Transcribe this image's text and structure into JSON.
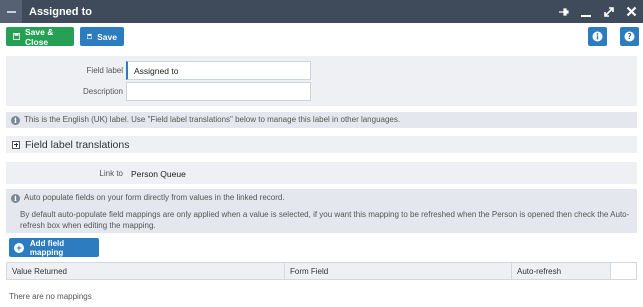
{
  "titlebar": {
    "title": "Assigned to"
  },
  "toolbar": {
    "save_close_label": "Save & Close",
    "save_label": "Save"
  },
  "form": {
    "field_label_caption": "Field label",
    "field_label_value": "Assigned to",
    "description_caption": "Description",
    "description_value": ""
  },
  "info1": "This is the English (UK) label. Use \"Field label translations\" below to manage this label in other languages.",
  "translations_header": "Field label translations",
  "link": {
    "caption": "Link to",
    "value": "Person Queue"
  },
  "info2": {
    "line1": "Auto populate fields on your form directly from values in the linked record.",
    "line2": "By default auto-populate field mappings are only applied when a value is selected, if you want this mapping to be refreshed when the Person is opened then check the Auto-refresh box when editing the mapping."
  },
  "add_mapping_label": "Add field mapping",
  "table": {
    "columns": [
      "Value Returned",
      "Form Field",
      "Auto-refresh"
    ],
    "empty_text": "There are no mappings"
  },
  "colors": {
    "titlebar": "#3f4b5b",
    "save_close": "#25a055",
    "primary": "#2c7cbf"
  }
}
